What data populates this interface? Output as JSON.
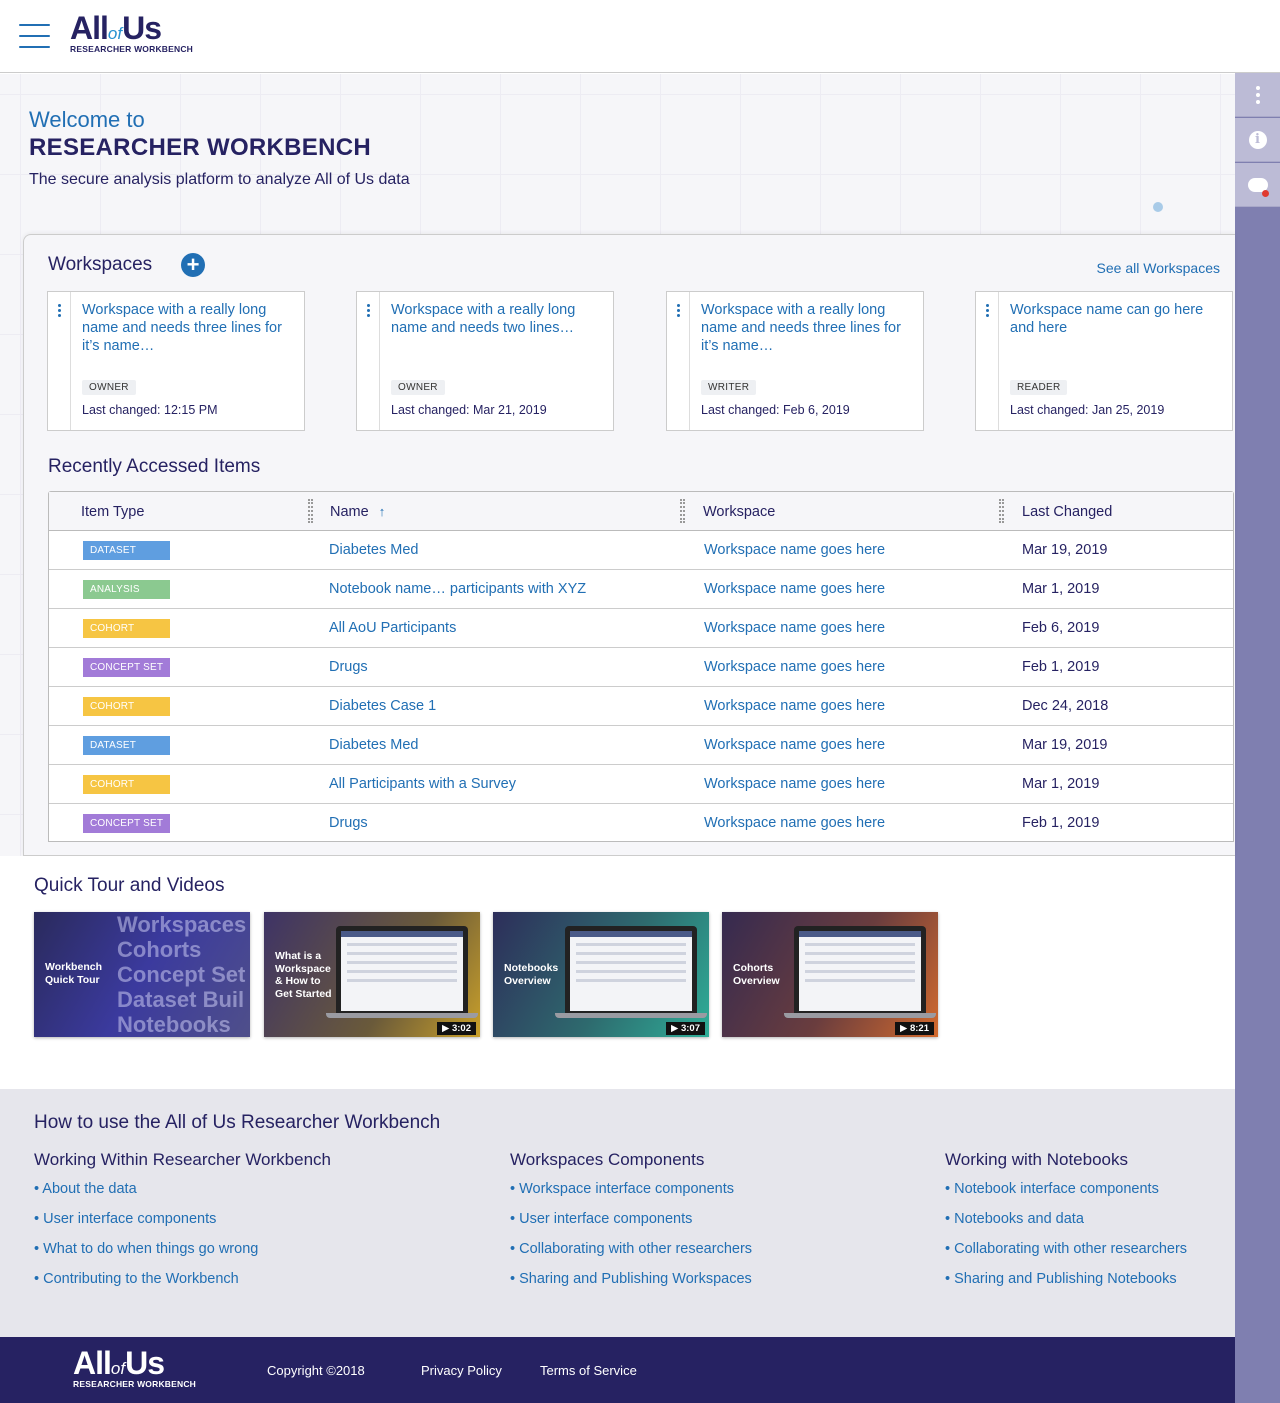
{
  "header": {
    "logo_main_a": "All",
    "logo_of": "of",
    "logo_main_b": "Us",
    "logo_sub": "RESEARCHER WORKBENCH"
  },
  "welcome": {
    "line1": "Welcome to",
    "line2": "RESEARCHER WORKBENCH",
    "line3": "The secure analysis platform to analyze All of Us data"
  },
  "workspaces": {
    "title": "Workspaces",
    "see_all": "See all Workspaces",
    "cards": [
      {
        "name": "Workspace with a really long name and needs three lines for it’s name…",
        "role": "OWNER",
        "last_changed": "Last changed: 12:15 PM"
      },
      {
        "name": "Workspace with a really long name and needs two lines…",
        "role": "OWNER",
        "last_changed": "Last changed: Mar 21, 2019"
      },
      {
        "name": "Workspace with a really long name and needs three lines for it’s name…",
        "role": "WRITER",
        "last_changed": "Last changed: Feb 6, 2019"
      },
      {
        "name": "Workspace name can go here and here",
        "role": "READER",
        "last_changed": "Last changed: Jan 25, 2019"
      }
    ]
  },
  "recent": {
    "title": "Recently Accessed Items",
    "columns": {
      "type": "Item Type",
      "name": "Name",
      "workspace": "Workspace",
      "changed": "Last Changed"
    },
    "rows": [
      {
        "type": "DATASET",
        "name": "Diabetes Med",
        "workspace": "Workspace name goes here",
        "changed": "Mar 19, 2019"
      },
      {
        "type": "ANALYSIS",
        "name": "Notebook name… participants with XYZ",
        "workspace": "Workspace name goes here",
        "changed": "Mar 1, 2019"
      },
      {
        "type": "COHORT",
        "name": "All AoU Participants",
        "workspace": "Workspace name goes here",
        "changed": "Feb 6, 2019"
      },
      {
        "type": "CONCEPT SET",
        "name": "Drugs",
        "workspace": "Workspace name goes here",
        "changed": "Feb 1, 2019"
      },
      {
        "type": "COHORT",
        "name": "Diabetes Case 1",
        "workspace": "Workspace name goes here",
        "changed": "Dec 24, 2018"
      },
      {
        "type": "DATASET",
        "name": "Diabetes Med",
        "workspace": "Workspace name goes here",
        "changed": "Mar 19, 2019"
      },
      {
        "type": "COHORT",
        "name": "All Participants with a Survey",
        "workspace": "Workspace name goes here",
        "changed": "Mar 1, 2019"
      },
      {
        "type": "CONCEPT SET",
        "name": "Drugs",
        "workspace": "Workspace name goes here",
        "changed": "Feb 1, 2019"
      }
    ],
    "badge_colors": {
      "DATASET": "#5f9ee0",
      "ANALYSIS": "#8bc990",
      "COHORT": "#f6c543",
      "CONCEPT SET": "#a27bd8"
    }
  },
  "tour": {
    "title": "Quick Tour and Videos",
    "videos": [
      {
        "label_1": "Workbench",
        "label_2": "Quick Tour",
        "words": [
          "Workspaces",
          "Cohorts",
          "Concept Set",
          "Dataset Buil",
          "Notebooks"
        ]
      },
      {
        "label_1": "What is a",
        "label_2": "Workspace",
        "label_3": "& How to",
        "label_4": "Get Started",
        "duration": "▶ 3:02"
      },
      {
        "label_1": "Notebooks",
        "label_2": "Overview",
        "duration": "▶ 3:07"
      },
      {
        "label_1": "Cohorts",
        "label_2": "Overview",
        "duration": "▶ 8:21"
      }
    ]
  },
  "howto": {
    "title": "How to use the All of Us Researcher Workbench",
    "columns": [
      {
        "heading": "Working Within Researcher Workbench",
        "links": [
          "• About the data",
          "• User interface components",
          "• What to do when things go wrong",
          "• Contributing to the Workbench"
        ]
      },
      {
        "heading": "Workspaces Components",
        "links": [
          "• Workspace interface components",
          "• User interface components",
          "• Collaborating with other researchers",
          "• Sharing and Publishing Workspaces"
        ]
      },
      {
        "heading": "Working with Notebooks",
        "links": [
          "• Notebook interface components",
          "• Notebooks and data",
          "• Collaborating with other researchers",
          "• Sharing and Publishing Notebooks"
        ]
      }
    ]
  },
  "footer": {
    "copyright": "Copyright ©2018",
    "privacy": "Privacy Policy",
    "terms": "Terms of Service"
  },
  "icons": {
    "menu": "hamburger-menu-icon",
    "more": "more-vertical-icon",
    "info": "info-icon",
    "cloud": "cloud-status-icon",
    "add": "add-circle-icon",
    "sort": "sort-ascending-icon",
    "play": "play-icon"
  },
  "colors": {
    "brand_navy": "#262262",
    "link_blue": "#216fb4",
    "rail": "#7f7fb0"
  }
}
